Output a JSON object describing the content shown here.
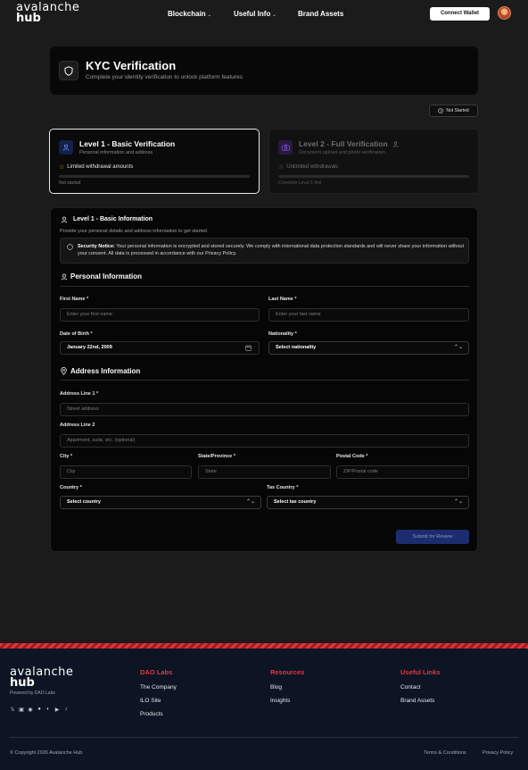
{
  "header": {
    "logo_line1": "avalanche",
    "logo_line2": "hub",
    "nav": [
      {
        "label": "Blockchain",
        "has_dropdown": true
      },
      {
        "label": "Useful Info",
        "has_dropdown": true
      },
      {
        "label": "Brand Assets",
        "has_dropdown": false
      }
    ],
    "connect_label": "Connect Wallet",
    "dropdown_caret": "⌄"
  },
  "kyc": {
    "title": "KYC Verification",
    "subtitle": "Complete your identity verification to unlock platform features",
    "status": "Not Started",
    "icon": "shield-icon"
  },
  "levels": [
    {
      "title": "Level 1 - Basic Verification",
      "subtitle": "Personal information and address",
      "feature": "Limited withdrawal amounts",
      "status": "Not started",
      "icon": "user-icon",
      "progress": 0
    },
    {
      "title": "Level 2 - Full Verification",
      "subtitle": "Document upload and photo verification",
      "feature": "Unlimited withdrawals",
      "status": "Complete Level 1 first",
      "icon": "camera-icon",
      "locked": true,
      "progress": 0
    }
  ],
  "form": {
    "title": "Level 1 - Basic Information",
    "subtitle": "Provide your personal details and address information to get started",
    "notice_label": "Security Notice:",
    "notice_text": "Your personal information is encrypted and stored securely. We comply with international data protection standards and will never share your information without your consent. All data is processed in accordance with our Privacy Policy.",
    "personal_title": "Personal Information",
    "address_title": "Address Information",
    "first_name_label": "First Name *",
    "first_name_placeholder": "Enter your first name",
    "last_name_label": "Last Name *",
    "last_name_placeholder": "Enter your last name",
    "dob_label": "Date of Birth *",
    "dob_value": "January 22nd, 2009",
    "nationality_label": "Nationality *",
    "nationality_value": "Select nationality",
    "address1_label": "Address Line 1 *",
    "address1_placeholder": "Street address",
    "address2_label": "Address Line 2",
    "address2_placeholder": "Apartment, suite, etc. (optional)",
    "city_label": "City *",
    "city_placeholder": "City",
    "state_label": "State/Province *",
    "state_placeholder": "State",
    "postal_label": "Postal Code *",
    "postal_placeholder": "ZIP/Postal code",
    "country_label": "Country *",
    "country_value": "Select country",
    "tax_country_label": "Tax Country *",
    "tax_country_value": "Select tax country",
    "submit_label": "Submit for Review",
    "select_chevron": "⌃⌄"
  },
  "footer": {
    "logo_line1": "avalanche",
    "logo_line2": "hub",
    "powered": "Powered by DAO Labs",
    "socials": [
      "x-icon",
      "linkedin-icon",
      "discord-icon",
      "reddit-icon",
      "medium-icon",
      "youtube-icon",
      "tiktok-icon"
    ],
    "columns": [
      {
        "title": "DAO Labs",
        "links": [
          "The Company",
          "ILO Site",
          "Products"
        ]
      },
      {
        "title": "Resources",
        "links": [
          "Blog",
          "Insights"
        ]
      },
      {
        "title": "Useful Links",
        "links": [
          "Contact",
          "Brand Assets"
        ]
      }
    ],
    "copyright": "© Copyright 2026 Avalanche Hub",
    "terms": "Terms & Conditions",
    "privacy": "Privacy Policy"
  },
  "colors": {
    "accent_red": "#e8353d",
    "footer_bg": "#0d1424",
    "submit_bg": "#1c2c6e"
  }
}
